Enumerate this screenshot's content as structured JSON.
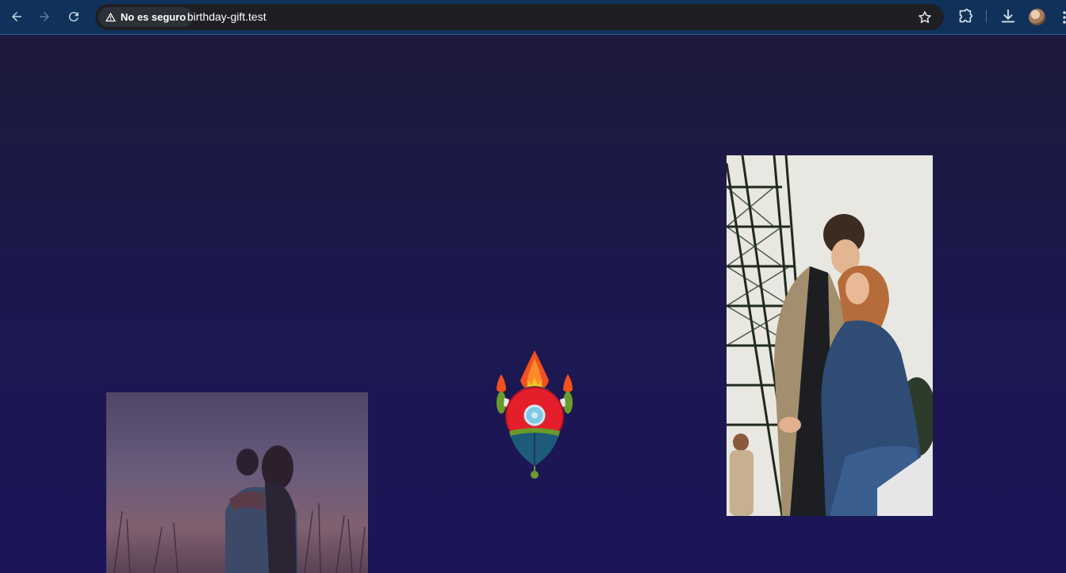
{
  "browser": {
    "security_label": "No es seguro",
    "url": "birthday-gift.test",
    "icons": [
      "back-arrow-icon",
      "forward-arrow-icon",
      "reload-icon",
      "warning-icon",
      "star-icon",
      "extensions-icon",
      "download-icon",
      "profile-avatar",
      "menu-icon"
    ]
  },
  "page": {
    "background_color": "#1c1850",
    "photos": [
      {
        "name": "couple-in-field-photo",
        "description_icon": "image"
      },
      {
        "name": "couple-eiffel-tower-photo",
        "description_icon": "image"
      }
    ],
    "rocket": {
      "icon": "rocket-icon",
      "colors": {
        "flame": "#f25a1a",
        "body": "#e41f2b",
        "base": "#1d5b7a",
        "window": "#7ec8e3",
        "fins": "#6a9a2a"
      }
    }
  }
}
